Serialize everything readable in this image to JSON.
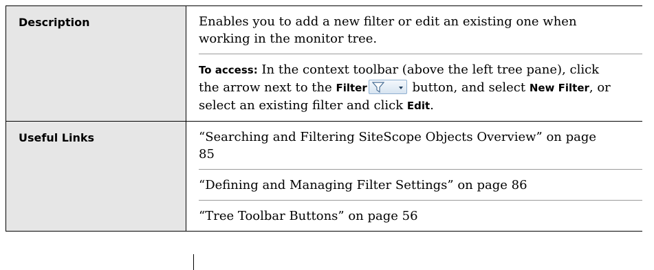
{
  "rows": [
    {
      "label": "Description",
      "paragraphs": [
        {
          "text": "Enables you to add a new filter or edit an existing one when working in the monitor tree."
        },
        {
          "access": {
            "prefix": "To access:",
            "text1": " In the context toolbar (above the left tree pane), click the arrow next to the ",
            "filter_label": "Filter",
            "text2": " button, and select ",
            "new_filter": "New Filter",
            "text3": ", or select an existing filter and click ",
            "edit": "Edit",
            "text4": "."
          }
        }
      ]
    },
    {
      "label": "Useful Links",
      "links": [
        "“Searching and Filtering SiteScope Objects Overview” on page 85",
        "“Defining and Managing Filter Settings” on page 86",
        "“Tree Toolbar Buttons” on page 56"
      ]
    }
  ],
  "icons": {
    "filter_button": "funnel-icon",
    "dropdown": "chevron-down-icon"
  },
  "colors": {
    "label_background": "#e6e6e6",
    "border": "#000000",
    "divider": "#9a9a9a"
  }
}
